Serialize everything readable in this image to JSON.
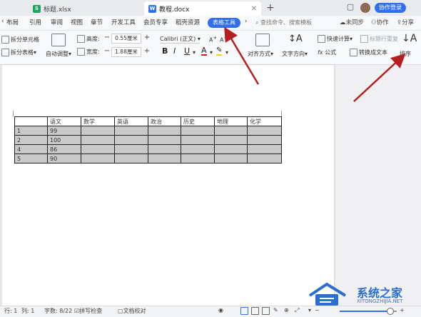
{
  "tabs": [
    {
      "label": "标题.xlsx",
      "icon": "spreadsheet-icon",
      "color": "#1ea362",
      "active": false
    },
    {
      "label": "教程.docx",
      "icon": "word-doc-icon",
      "color": "#2f6ff0",
      "active": true
    }
  ],
  "login_label": "协作登录",
  "menus": [
    "布局",
    "引用",
    "审阅",
    "视图",
    "章节",
    "开发工具",
    "会员专享",
    "稻壳资源"
  ],
  "table_tools_label": "表格工具",
  "search_placeholder": "查找命令、搜索模板",
  "right_menus": [
    "未同步",
    "协作",
    "分享"
  ],
  "ribbon": {
    "split_cell": "拆分单元格",
    "split_table": "拆分表格",
    "autofit": "自动调整",
    "height_label": "高度:",
    "height_value": "0.55厘米",
    "width_label": "宽度:",
    "width_value": "1.88厘米",
    "font_name": "Calibri (正文)",
    "align": "对齐方式",
    "text_dir": "文字方向",
    "quick_calc": "快速计算",
    "title_repeat": "标题行重复",
    "formula": "公式",
    "to_text": "转换成文本",
    "sort": "排序"
  },
  "table": {
    "header": [
      "",
      "语文",
      "数学",
      "英语",
      "政治",
      "历史",
      "地理",
      "化学"
    ],
    "rows": [
      [
        "1",
        "99",
        "",
        "",
        "",
        "",
        "",
        ""
      ],
      [
        "2",
        "100",
        "",
        "",
        "",
        "",
        "",
        ""
      ],
      [
        "4",
        "86",
        "",
        "",
        "",
        "",
        "",
        ""
      ],
      [
        "5",
        "90",
        "",
        "",
        "",
        "",
        "",
        ""
      ]
    ]
  },
  "status": {
    "row": "行: 1",
    "col": "列: 1",
    "word_count": "字数: 8/22",
    "spell_check": "拼写检查",
    "doc_check": "文档校对"
  },
  "watermark": {
    "title": "系统之家",
    "sub": "XITONGZHIJIA.NET"
  },
  "annotation_color": "#b51f1f"
}
